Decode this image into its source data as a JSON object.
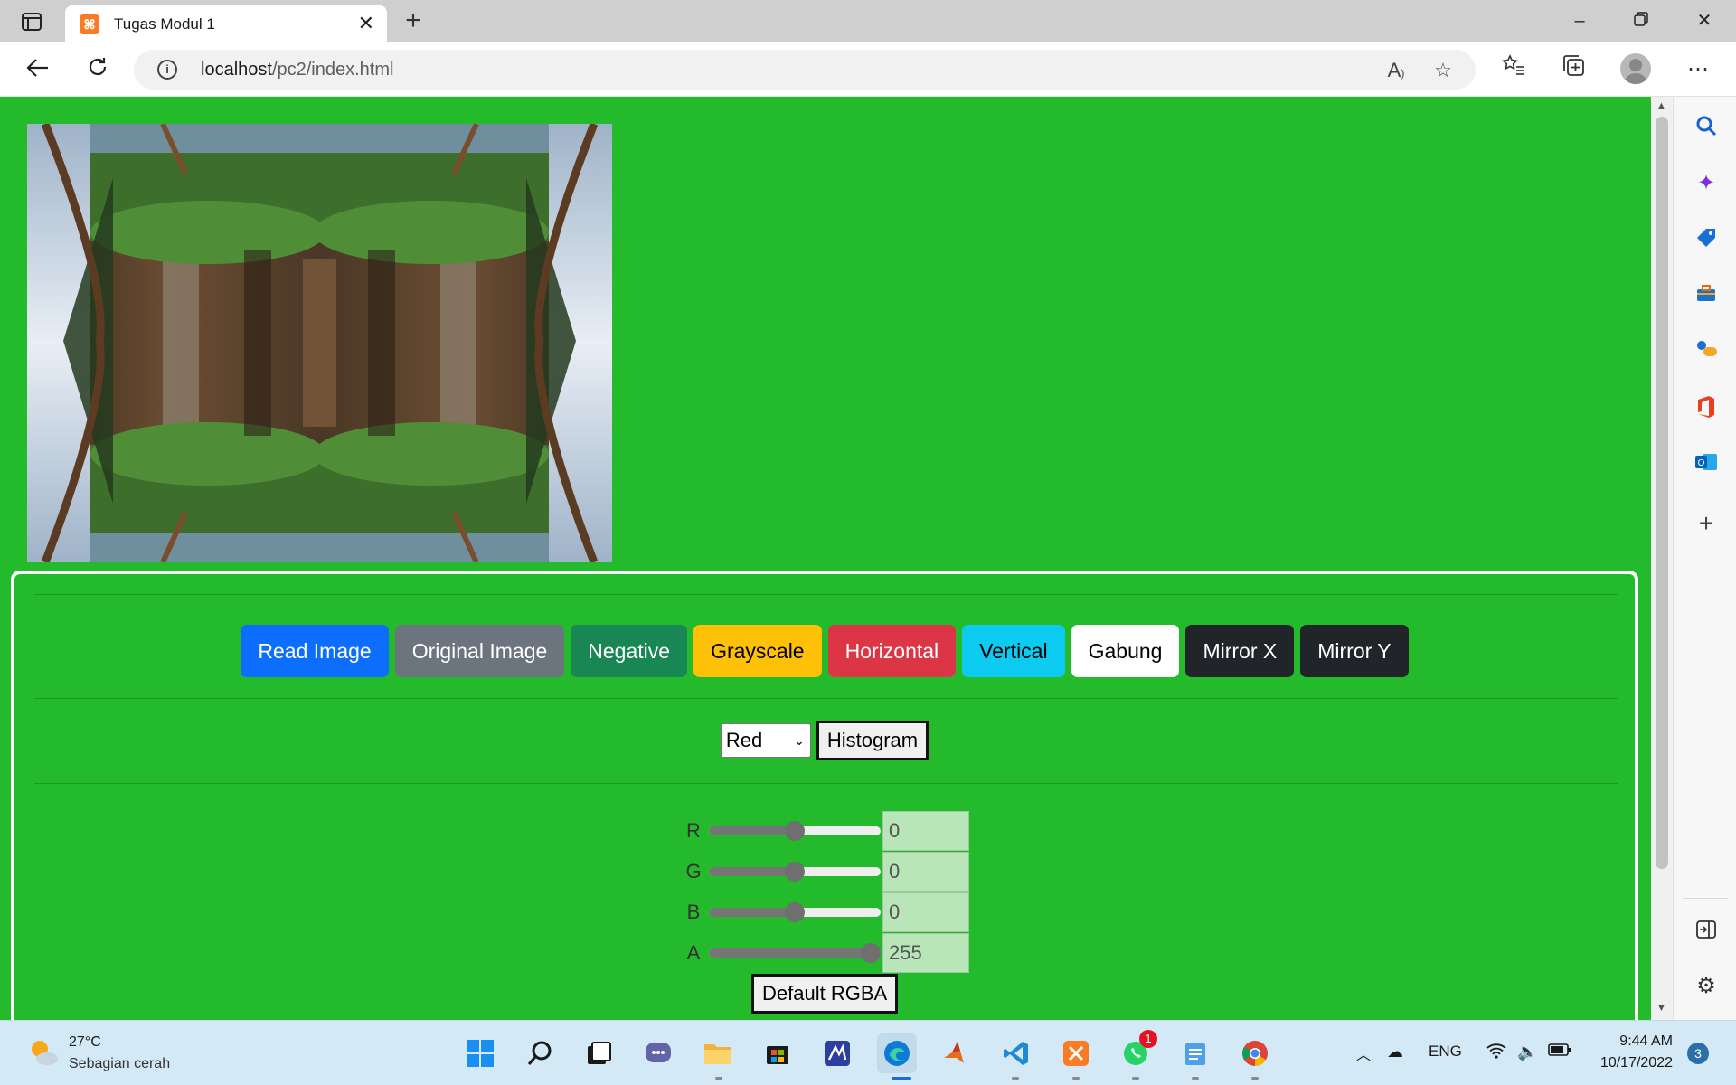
{
  "browser": {
    "tab_title": "Tugas Modul 1",
    "tab_favicon": "xampp-icon",
    "url_host": "localhost",
    "url_path": "/pc2/index.html"
  },
  "page": {
    "image_alt": "mirrored waterfall forest image",
    "buttons": [
      {
        "label": "Read Image",
        "color": "#0d6efd",
        "text_color": "#ffffff"
      },
      {
        "label": "Original Image",
        "color": "#6c757d",
        "text_color": "#ffffff"
      },
      {
        "label": "Negative",
        "color": "#198754",
        "text_color": "#ffffff"
      },
      {
        "label": "Grayscale",
        "color": "#ffc107",
        "text_color": "#000000"
      },
      {
        "label": "Horizontal",
        "color": "#dc3545",
        "text_color": "#ffffff"
      },
      {
        "label": "Vertical",
        "color": "#0dcaf0",
        "text_color": "#000000"
      },
      {
        "label": "Gabung",
        "color": "#ffffff",
        "text_color": "#000000"
      },
      {
        "label": "Mirror X",
        "color": "#212529",
        "text_color": "#ffffff"
      },
      {
        "label": "Mirror Y",
        "color": "#212529",
        "text_color": "#ffffff"
      }
    ],
    "histogram": {
      "select_value": "Red",
      "button_label": "Histogram"
    },
    "rgba": [
      {
        "label": "R",
        "value": "0",
        "slider_fraction": 0.5
      },
      {
        "label": "G",
        "value": "0",
        "slider_fraction": 0.5
      },
      {
        "label": "B",
        "value": "0",
        "slider_fraction": 0.5
      },
      {
        "label": "A",
        "value": "255",
        "slider_fraction": 1.0
      }
    ],
    "default_button": "Default RGBA",
    "background_color": "#23ba2c"
  },
  "taskbar": {
    "weather_temp": "27°C",
    "weather_desc": "Sebagian cerah",
    "language": "ENG",
    "time": "9:44 AM",
    "date": "10/17/2022",
    "notification_count": "3",
    "whatsapp_badge": "1"
  }
}
